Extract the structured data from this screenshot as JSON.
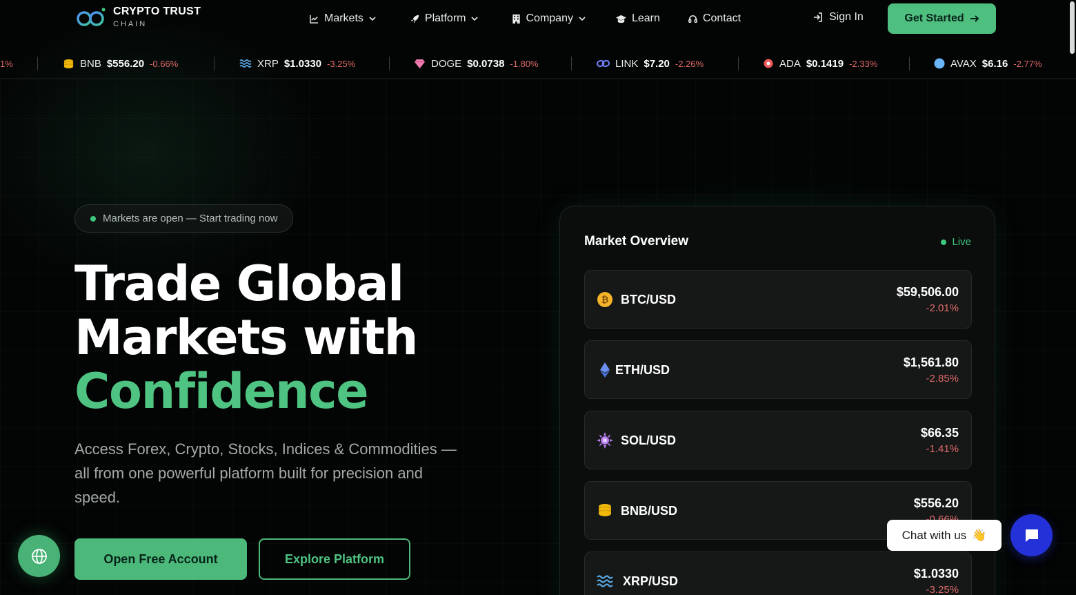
{
  "brand": {
    "name": "CRYPTO TRUST",
    "sub": "CHAIN"
  },
  "nav": {
    "items": [
      {
        "label": "Markets",
        "icon": "chart-line-icon",
        "has_dropdown": true
      },
      {
        "label": "Platform",
        "icon": "rocket-icon",
        "has_dropdown": true
      },
      {
        "label": "Company",
        "icon": "building-icon",
        "has_dropdown": true
      },
      {
        "label": "Learn",
        "icon": "graduation-cap-icon",
        "has_dropdown": false
      },
      {
        "label": "Contact",
        "icon": "headset-icon",
        "has_dropdown": false
      }
    ],
    "sign_in": "Sign In",
    "get_started": "Get Started"
  },
  "ticker": {
    "partial": "1%",
    "items": [
      {
        "symbol": "BNB",
        "price": "$556.20",
        "change": "-0.66%",
        "icon": "coins-icon"
      },
      {
        "symbol": "XRP",
        "price": "$1.0330",
        "change": "-3.25%",
        "icon": "waves-icon"
      },
      {
        "symbol": "DOGE",
        "price": "$0.0738",
        "change": "-1.80%",
        "icon": "gem-icon"
      },
      {
        "symbol": "LINK",
        "price": "$7.20",
        "change": "-2.26%",
        "icon": "link-icon"
      },
      {
        "symbol": "ADA",
        "price": "$0.1419",
        "change": "-2.33%",
        "icon": "ring-icon"
      },
      {
        "symbol": "AVAX",
        "price": "$6.16",
        "change": "-2.77%",
        "icon": "circle-icon"
      }
    ]
  },
  "hero": {
    "badge": "Markets are open — Start trading now",
    "title_line1": "Trade Global",
    "title_line2": "Markets with",
    "title_accent": "Confidence",
    "description": "Access Forex, Crypto, Stocks, Indices & Commodities — all from one powerful platform built for precision and speed.",
    "primary_cta": "Open Free Account",
    "secondary_cta": "Explore Platform"
  },
  "market_overview": {
    "title": "Market Overview",
    "status": "Live",
    "rows": [
      {
        "pair": "BTC/USD",
        "price": "$59,506.00",
        "change": "-2.01%",
        "icon": "bitcoin-icon"
      },
      {
        "pair": "ETH/USD",
        "price": "$1,561.80",
        "change": "-2.85%",
        "icon": "ethereum-icon"
      },
      {
        "pair": "SOL/USD",
        "price": "$66.35",
        "change": "-1.41%",
        "icon": "sun-icon"
      },
      {
        "pair": "BNB/USD",
        "price": "$556.20",
        "change": "-0.66%",
        "icon": "coins-icon"
      },
      {
        "pair": "XRP/USD",
        "price": "$1.0330",
        "change": "-3.25%",
        "icon": "waves-icon"
      }
    ]
  },
  "chat": {
    "label": "Chat with us",
    "emoji": "👋"
  },
  "colors": {
    "accent": "#4fc482",
    "negative": "#e06a6a",
    "chat": "#2431d8"
  }
}
